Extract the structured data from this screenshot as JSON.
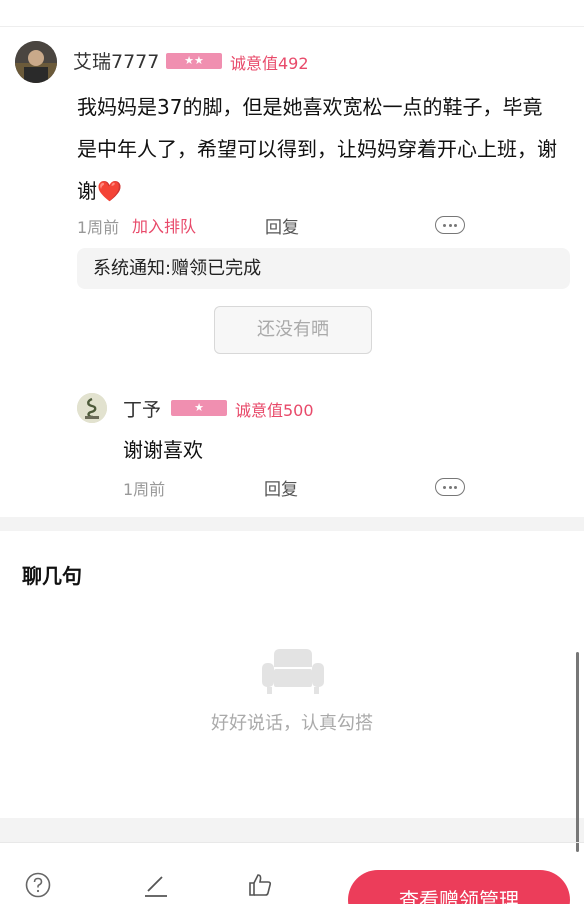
{
  "comment": {
    "username": "艾瑞7777",
    "level_badge": "★★",
    "sincerity": "诚意值492",
    "text": "我妈妈是37的脚，但是她喜欢宽松一点的鞋子，毕竟是中年人了，希望可以得到，让妈妈穿着开心上班，谢谢",
    "emoji": "❤️",
    "time": "1周前",
    "join_queue": "加入排队",
    "reply": "回复",
    "system_notice": "系统通知:赠领已完成",
    "not_shown_button": "还没有晒"
  },
  "reply_comment": {
    "username": "丁予",
    "level_badge": "★",
    "sincerity": "诚意值500",
    "text": "谢谢喜欢",
    "time": "1周前",
    "reply": "回复"
  },
  "chat_section": {
    "title": "聊几句",
    "empty_text": "好好说话，认真勾搭"
  },
  "bottom_bar": {
    "help_icon": "question-circle-icon",
    "edit_icon": "pen-icon",
    "like_icon": "thumbs-up-icon",
    "manage_button": "查看赠领管理",
    "accent_color": "#ec3d5a"
  }
}
